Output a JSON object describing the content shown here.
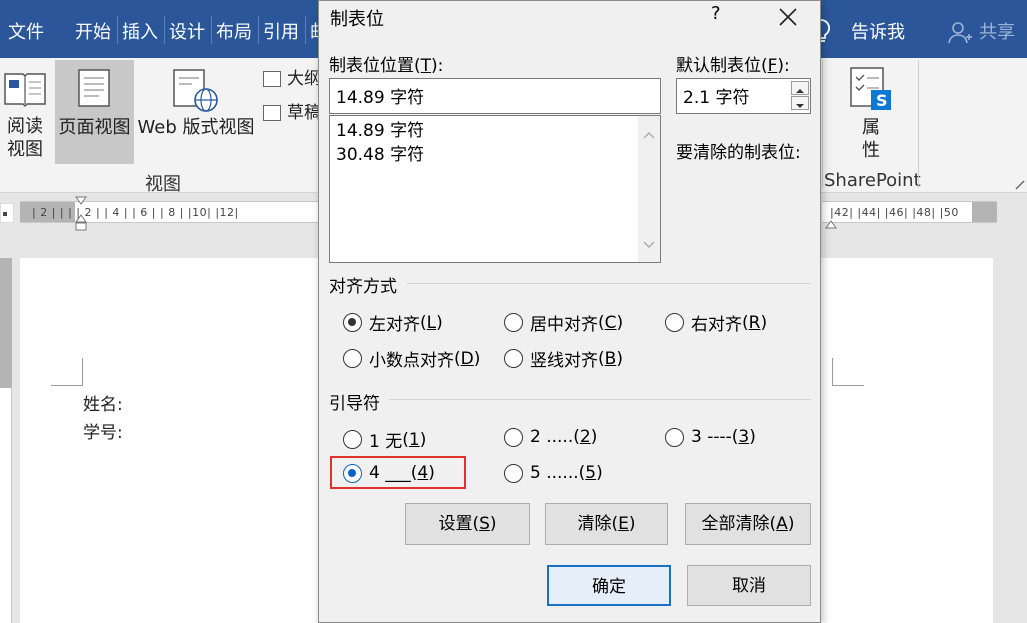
{
  "menubar": {
    "items": [
      "文件",
      "开始",
      "插入",
      "设计",
      "布局",
      "引用",
      "邮"
    ],
    "tell_me": "告诉我",
    "share": "共享"
  },
  "ribbon": {
    "read_view_line1": "阅读",
    "read_view_line2": "视图",
    "page_view": "页面视图",
    "web_view": "Web 版式视图",
    "outline_partial": "大纲",
    "draft_partial": "草稿",
    "group_view": "视图",
    "properties_line1": "属",
    "properties_line2": "性",
    "sharepoint": "SharePoint"
  },
  "ruler": {
    "left_ticks": "| 2 |  |  |  | 2 |  | 4 |  | 6 |  | 8 |  |10|  |12|",
    "right_ticks": "|42|  |44|  |46|  |48|  |50"
  },
  "document": {
    "line1": "姓名:",
    "line2": "学号:"
  },
  "dialog": {
    "title": "制表位",
    "help": "?",
    "tab_position_label": "制表位位置",
    "tab_position_key": "T",
    "tab_position_value": "14.89 字符",
    "tab_list": [
      "14.89 字符",
      "30.48 字符"
    ],
    "default_tab_label": "默认制表位",
    "default_tab_key": "F",
    "default_tab_value": "2.1 字符",
    "clear_label": "要清除的制表位:",
    "alignment_label": "对齐方式",
    "alignment": [
      {
        "text": "左对齐",
        "key": "L",
        "checked": true
      },
      {
        "text": "居中对齐",
        "key": "C",
        "checked": false
      },
      {
        "text": "右对齐",
        "key": "R",
        "checked": false
      },
      {
        "text": "小数点对齐",
        "key": "D",
        "checked": false
      },
      {
        "text": "竖线对齐",
        "key": "B",
        "checked": false
      }
    ],
    "leader_label": "引导符",
    "leader": [
      {
        "text": "1 无",
        "key": "1",
        "checked": false
      },
      {
        "text": "2 .....",
        "key": "2",
        "checked": false
      },
      {
        "text": "3 ----",
        "key": "3",
        "checked": false
      },
      {
        "text": "4 ___",
        "key": "4",
        "checked": true
      },
      {
        "text": "5 ......",
        "key": "5",
        "checked": false
      }
    ],
    "buttons": {
      "set": "设置",
      "set_key": "S",
      "clear": "清除",
      "clear_key": "E",
      "clear_all": "全部清除",
      "clear_all_key": "A",
      "ok": "确定",
      "cancel": "取消"
    }
  },
  "colors": {
    "menubar": "#2b579a",
    "highlight": "#e0312c",
    "radio_selected": "#0a64c8"
  }
}
